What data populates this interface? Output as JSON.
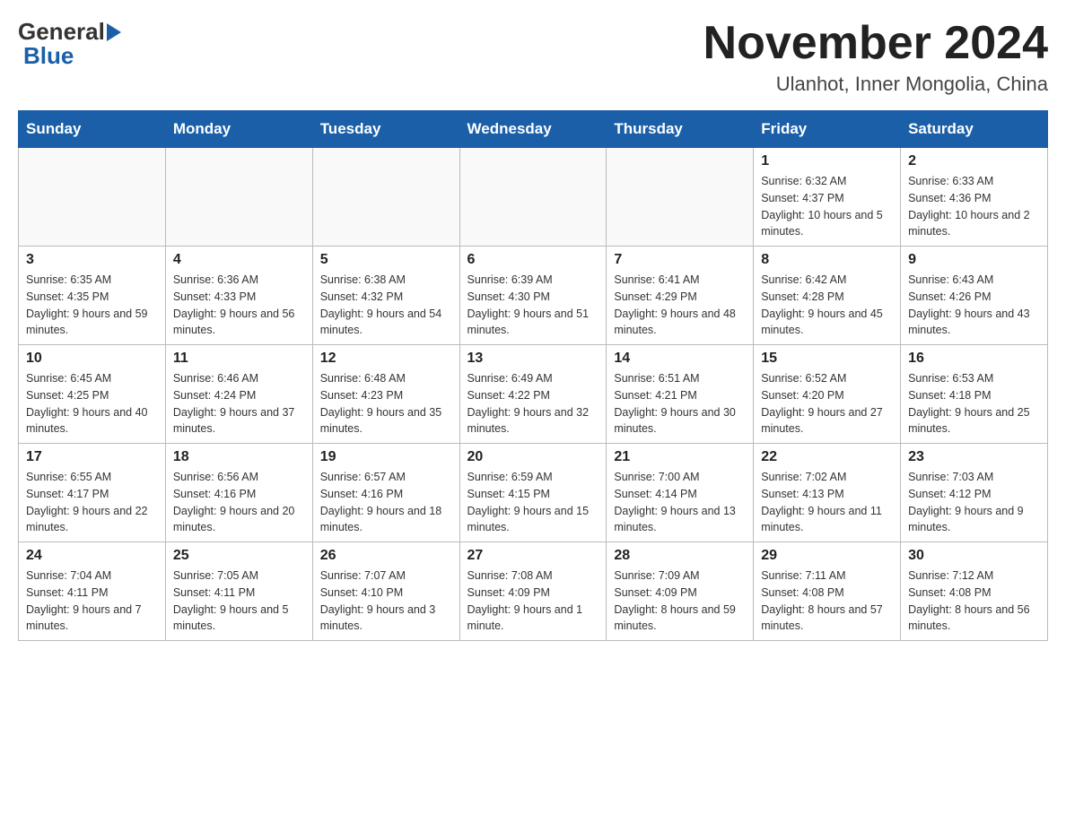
{
  "logo": {
    "line1": "General",
    "triangle": "▶",
    "line2": "Blue"
  },
  "title": "November 2024",
  "subtitle": "Ulanhot, Inner Mongolia, China",
  "days_of_week": [
    "Sunday",
    "Monday",
    "Tuesday",
    "Wednesday",
    "Thursday",
    "Friday",
    "Saturday"
  ],
  "weeks": [
    [
      {
        "day": "",
        "info": ""
      },
      {
        "day": "",
        "info": ""
      },
      {
        "day": "",
        "info": ""
      },
      {
        "day": "",
        "info": ""
      },
      {
        "day": "",
        "info": ""
      },
      {
        "day": "1",
        "info": "Sunrise: 6:32 AM\nSunset: 4:37 PM\nDaylight: 10 hours and 5 minutes."
      },
      {
        "day": "2",
        "info": "Sunrise: 6:33 AM\nSunset: 4:36 PM\nDaylight: 10 hours and 2 minutes."
      }
    ],
    [
      {
        "day": "3",
        "info": "Sunrise: 6:35 AM\nSunset: 4:35 PM\nDaylight: 9 hours and 59 minutes."
      },
      {
        "day": "4",
        "info": "Sunrise: 6:36 AM\nSunset: 4:33 PM\nDaylight: 9 hours and 56 minutes."
      },
      {
        "day": "5",
        "info": "Sunrise: 6:38 AM\nSunset: 4:32 PM\nDaylight: 9 hours and 54 minutes."
      },
      {
        "day": "6",
        "info": "Sunrise: 6:39 AM\nSunset: 4:30 PM\nDaylight: 9 hours and 51 minutes."
      },
      {
        "day": "7",
        "info": "Sunrise: 6:41 AM\nSunset: 4:29 PM\nDaylight: 9 hours and 48 minutes."
      },
      {
        "day": "8",
        "info": "Sunrise: 6:42 AM\nSunset: 4:28 PM\nDaylight: 9 hours and 45 minutes."
      },
      {
        "day": "9",
        "info": "Sunrise: 6:43 AM\nSunset: 4:26 PM\nDaylight: 9 hours and 43 minutes."
      }
    ],
    [
      {
        "day": "10",
        "info": "Sunrise: 6:45 AM\nSunset: 4:25 PM\nDaylight: 9 hours and 40 minutes."
      },
      {
        "day": "11",
        "info": "Sunrise: 6:46 AM\nSunset: 4:24 PM\nDaylight: 9 hours and 37 minutes."
      },
      {
        "day": "12",
        "info": "Sunrise: 6:48 AM\nSunset: 4:23 PM\nDaylight: 9 hours and 35 minutes."
      },
      {
        "day": "13",
        "info": "Sunrise: 6:49 AM\nSunset: 4:22 PM\nDaylight: 9 hours and 32 minutes."
      },
      {
        "day": "14",
        "info": "Sunrise: 6:51 AM\nSunset: 4:21 PM\nDaylight: 9 hours and 30 minutes."
      },
      {
        "day": "15",
        "info": "Sunrise: 6:52 AM\nSunset: 4:20 PM\nDaylight: 9 hours and 27 minutes."
      },
      {
        "day": "16",
        "info": "Sunrise: 6:53 AM\nSunset: 4:18 PM\nDaylight: 9 hours and 25 minutes."
      }
    ],
    [
      {
        "day": "17",
        "info": "Sunrise: 6:55 AM\nSunset: 4:17 PM\nDaylight: 9 hours and 22 minutes."
      },
      {
        "day": "18",
        "info": "Sunrise: 6:56 AM\nSunset: 4:16 PM\nDaylight: 9 hours and 20 minutes."
      },
      {
        "day": "19",
        "info": "Sunrise: 6:57 AM\nSunset: 4:16 PM\nDaylight: 9 hours and 18 minutes."
      },
      {
        "day": "20",
        "info": "Sunrise: 6:59 AM\nSunset: 4:15 PM\nDaylight: 9 hours and 15 minutes."
      },
      {
        "day": "21",
        "info": "Sunrise: 7:00 AM\nSunset: 4:14 PM\nDaylight: 9 hours and 13 minutes."
      },
      {
        "day": "22",
        "info": "Sunrise: 7:02 AM\nSunset: 4:13 PM\nDaylight: 9 hours and 11 minutes."
      },
      {
        "day": "23",
        "info": "Sunrise: 7:03 AM\nSunset: 4:12 PM\nDaylight: 9 hours and 9 minutes."
      }
    ],
    [
      {
        "day": "24",
        "info": "Sunrise: 7:04 AM\nSunset: 4:11 PM\nDaylight: 9 hours and 7 minutes."
      },
      {
        "day": "25",
        "info": "Sunrise: 7:05 AM\nSunset: 4:11 PM\nDaylight: 9 hours and 5 minutes."
      },
      {
        "day": "26",
        "info": "Sunrise: 7:07 AM\nSunset: 4:10 PM\nDaylight: 9 hours and 3 minutes."
      },
      {
        "day": "27",
        "info": "Sunrise: 7:08 AM\nSunset: 4:09 PM\nDaylight: 9 hours and 1 minute."
      },
      {
        "day": "28",
        "info": "Sunrise: 7:09 AM\nSunset: 4:09 PM\nDaylight: 8 hours and 59 minutes."
      },
      {
        "day": "29",
        "info": "Sunrise: 7:11 AM\nSunset: 4:08 PM\nDaylight: 8 hours and 57 minutes."
      },
      {
        "day": "30",
        "info": "Sunrise: 7:12 AM\nSunset: 4:08 PM\nDaylight: 8 hours and 56 minutes."
      }
    ]
  ]
}
